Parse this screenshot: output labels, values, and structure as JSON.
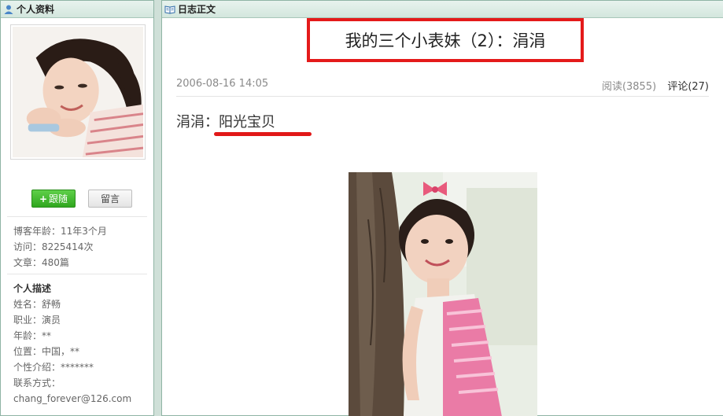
{
  "left_panel": {
    "header": "个人资料",
    "follow_button": "跟随",
    "message_button": "留言",
    "stats": {
      "blog_age": "博客年龄：11年3个月",
      "visits": "访问：8225414次",
      "articles": "文章：480篇"
    },
    "description": {
      "title": "个人描述",
      "name": "姓名：舒畅",
      "job": "职业：演员",
      "age": "年龄：**",
      "location": "位置：中国，**",
      "intro": "个性介绍：*******",
      "contact": "联系方式：",
      "email": "chang_forever@126.com"
    }
  },
  "right_panel": {
    "header": "日志正文",
    "headline": "我的三个小表妹（2）：涓涓",
    "date": "2006-08-16 14:05",
    "reads": "阅读(3855)",
    "comments": "评论(27)",
    "body_prefix": "涓涓：",
    "body_highlight": "阳光宝贝"
  },
  "colors": {
    "accent_red": "#e41a1a",
    "follow_green": "#2fa61e",
    "panel_border": "#8fb4a5"
  },
  "icons": {
    "profile": "user-icon",
    "journal": "open-book-icon"
  }
}
